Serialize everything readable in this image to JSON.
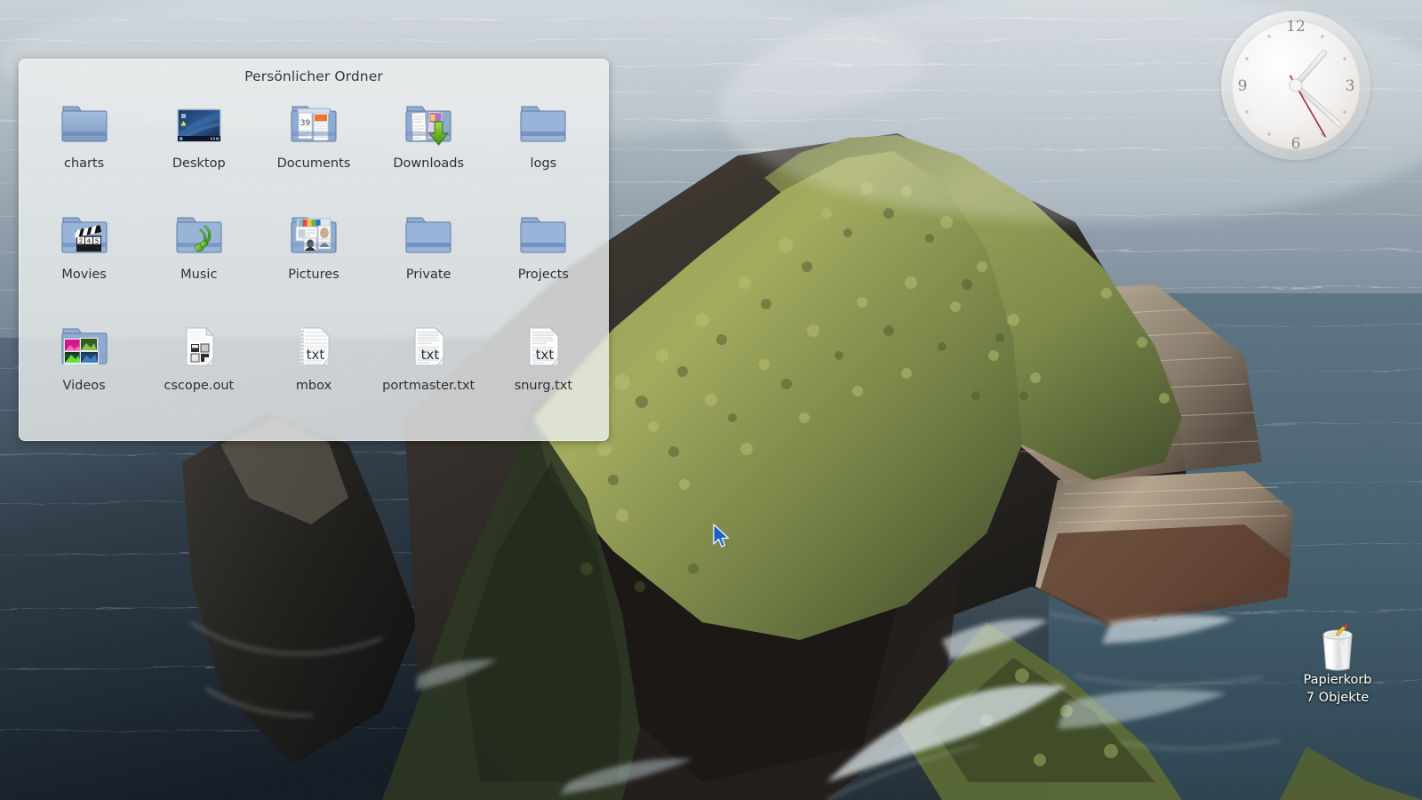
{
  "desktop": {
    "environment_language": "de",
    "wallpaper": {
      "name": "coastal-cliff-ocean-aerial",
      "colors": {
        "sky_water_top": "#c3ccd2",
        "water_mid": "#6e7f8c",
        "water_deep": "#2b3640",
        "water_dark": "#19222b",
        "cliff_green_light": "#9aa259",
        "cliff_green_dark": "#4e5a31",
        "cliff_rock_light": "#b7a58e",
        "cliff_rock_dark": "#3a3630",
        "foam_white": "#e8eef1"
      }
    }
  },
  "folder_panel": {
    "title": "Persönlicher Ordner",
    "background_color": "#eef0f0",
    "items": [
      {
        "label": "charts",
        "icon": "folder-icon",
        "type": "folder"
      },
      {
        "label": "Desktop",
        "icon": "folder-desktop-icon",
        "type": "folder"
      },
      {
        "label": "Documents",
        "icon": "folder-documents-icon",
        "type": "folder"
      },
      {
        "label": "Downloads",
        "icon": "folder-downloads-icon",
        "type": "folder"
      },
      {
        "label": "logs",
        "icon": "folder-icon",
        "type": "folder"
      },
      {
        "label": "Movies",
        "icon": "folder-videos-icon",
        "type": "folder"
      },
      {
        "label": "Music",
        "icon": "folder-music-icon",
        "type": "folder"
      },
      {
        "label": "Pictures",
        "icon": "folder-pictures-icon",
        "type": "folder"
      },
      {
        "label": "Private",
        "icon": "folder-icon",
        "type": "folder"
      },
      {
        "label": "Projects",
        "icon": "folder-icon",
        "type": "folder"
      },
      {
        "label": "Videos",
        "icon": "folder-images-icon",
        "type": "folder"
      },
      {
        "label": "cscope.out",
        "icon": "file-generic-icon",
        "type": "file"
      },
      {
        "label": "mbox",
        "icon": "file-text-lined-icon",
        "type": "file"
      },
      {
        "label": "portmaster.txt",
        "icon": "file-txt-icon",
        "type": "file"
      },
      {
        "label": "snurg.txt",
        "icon": "file-txt-icon",
        "type": "file"
      }
    ]
  },
  "clock": {
    "name": "analog-clock-widget",
    "hour": 1,
    "minute": 22,
    "second": 25,
    "numerals": [
      "12",
      "3",
      "6",
      "9"
    ],
    "face_color": "#f2f0ee",
    "hand_color": "#f7f7f7",
    "second_hand_color": "#a83236"
  },
  "trash": {
    "icon": "trash-can-icon",
    "label": "Papierkorb",
    "count_label": "7 Objekte"
  },
  "cursor": {
    "icon": "mouse-pointer-icon",
    "color": "#1b5fc4"
  }
}
